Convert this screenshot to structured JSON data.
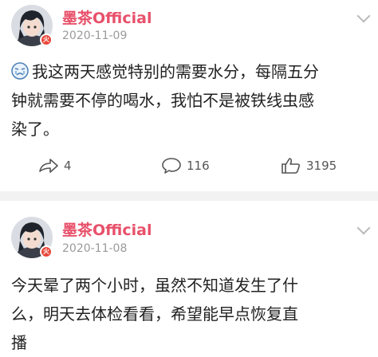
{
  "posts": [
    {
      "author": "墨茶Official",
      "time": "2020-11-09",
      "badge_icon": "fire-badge-icon",
      "emoji_icon": "crying-face-emoji",
      "text": "我这两天感觉特别的需要水分，每隔五分\n钟就需要不停的喝水，我怕不是被铁线虫感\n染了。",
      "repost_count": "4",
      "comment_count": "116",
      "like_count": "3195"
    },
    {
      "author": "墨茶Official",
      "time": "2020-11-08",
      "badge_icon": "fire-badge-icon",
      "text": "今天晕了两个小时，虽然不知道发生了什\n么，明天去体检看看，希望能早点恢复直\n播"
    }
  ],
  "colors": {
    "author_name": "#e8506a",
    "timestamp": "#9a9a9a",
    "badge": "#e8473a",
    "separator": "#f2f2f2"
  }
}
